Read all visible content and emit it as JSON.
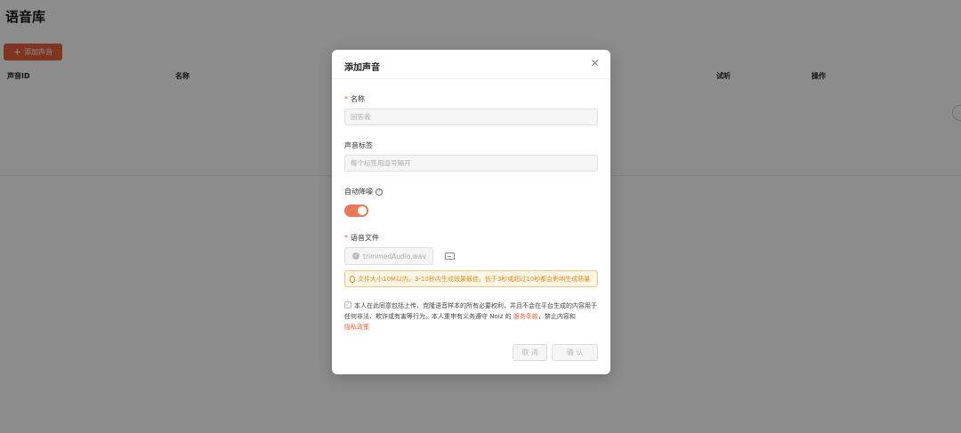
{
  "page": {
    "title": "语音库",
    "add_button_label": "添加声音",
    "columns": [
      "声音ID",
      "名称",
      "试听",
      "操作"
    ]
  },
  "modal": {
    "title": "添加声音",
    "close_icon": "close-icon",
    "name": {
      "label": "名称",
      "placeholder": "回答我"
    },
    "tags": {
      "label": "声音标签",
      "placeholder": "每个标签用逗号隔开"
    },
    "denoise": {
      "label": "自动降噪",
      "enabled": true
    },
    "file": {
      "label": "语音文件",
      "filename": "trimmedAudio.wav"
    },
    "warning": "文件大小10M以内，3-10秒内生成效果最佳，低于3秒或超过10秒都会影响生成质量",
    "agreement": {
      "text_1": "本人在此同意包括上传、克隆语音样本的所有必要权利，并且不会在平台生成的内容用于任何非法、欺诈或有害等行为。本人重申有义务遵守 Noiz 的 ",
      "terms_link": "服务条款",
      "text_2": "，禁止内容和",
      "privacy_link": "隐私政策"
    },
    "cancel_label": "取 消",
    "ok_label": "确 认",
    "accent_color": "#e8623a"
  }
}
